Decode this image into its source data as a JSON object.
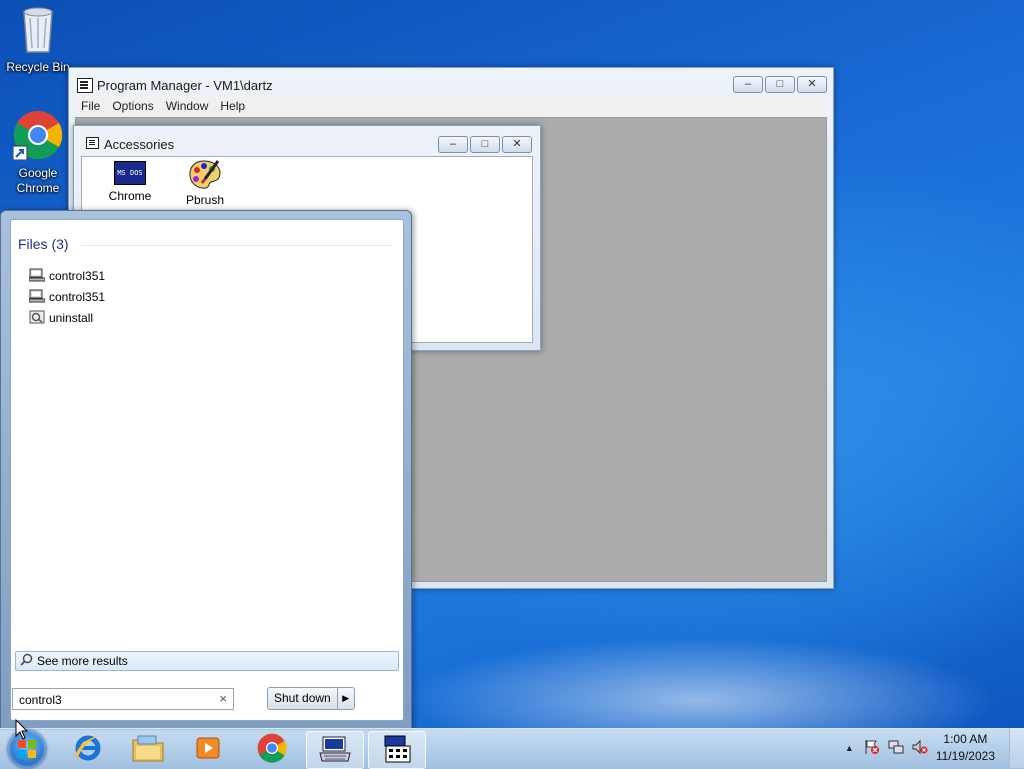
{
  "desktop": {
    "icons": [
      {
        "label": "Recycle Bin"
      },
      {
        "label": "Google Chrome"
      }
    ]
  },
  "program_manager": {
    "title": "Program Manager - VM1\\dartz",
    "menu": [
      "File",
      "Options",
      "Window",
      "Help"
    ],
    "buttons": {
      "minimize": "–",
      "maximize": "□",
      "close": "✕"
    }
  },
  "accessories": {
    "title": "Accessories",
    "programs": [
      {
        "label": "Chrome",
        "icon": "ms-dos-icon",
        "icon_text": "MS DOS"
      },
      {
        "label": "Pbrush",
        "icon": "paint-palette-icon"
      }
    ]
  },
  "start_menu": {
    "heading": "Files (3)",
    "results": [
      {
        "label": "control351",
        "icon": "computer-icon"
      },
      {
        "label": "control351",
        "icon": "computer-icon"
      },
      {
        "label": "uninstall",
        "icon": "settings-file-icon"
      }
    ],
    "see_more": "See more results",
    "search_value": "control3",
    "search_clear": "×",
    "shutdown_label": "Shut down",
    "shutdown_arrow": "▶"
  },
  "taskbar": {
    "items": [
      "internet-explorer-icon",
      "file-explorer-icon",
      "media-player-icon",
      "chrome-icon",
      "keyboard-app-icon",
      "program-manager-icon"
    ],
    "tray": {
      "show_hidden": "▲",
      "time": "1:00 AM",
      "date": "11/19/2023"
    }
  }
}
